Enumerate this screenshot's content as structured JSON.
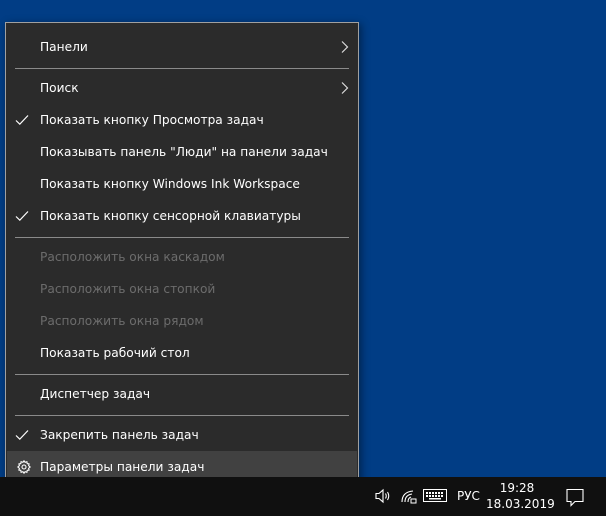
{
  "menu": {
    "items": [
      {
        "label": "Панели",
        "checked": false,
        "disabled": false,
        "submenu": true
      },
      {
        "label": "Поиск",
        "checked": false,
        "disabled": false,
        "submenu": true
      },
      {
        "label": "Показать кнопку Просмотра задач",
        "checked": true,
        "disabled": false
      },
      {
        "label": "Показывать панель \"Люди\" на панели задач",
        "checked": false,
        "disabled": false
      },
      {
        "label": "Показать кнопку Windows Ink Workspace",
        "checked": false,
        "disabled": false
      },
      {
        "label": "Показать кнопку сенсорной клавиатуры",
        "checked": true,
        "disabled": false
      },
      {
        "label": "Расположить окна каскадом",
        "checked": false,
        "disabled": true
      },
      {
        "label": "Расположить окна стопкой",
        "checked": false,
        "disabled": true
      },
      {
        "label": "Расположить окна рядом",
        "checked": false,
        "disabled": true
      },
      {
        "label": "Показать рабочий стол",
        "checked": false,
        "disabled": false
      },
      {
        "label": "Диспетчер задач",
        "checked": false,
        "disabled": false
      },
      {
        "label": "Закрепить панель задач",
        "checked": true,
        "disabled": false
      },
      {
        "label": "Параметры панели задач",
        "checked": false,
        "disabled": false,
        "icon": "gear-icon",
        "highlighted": true
      }
    ]
  },
  "taskbar": {
    "language": "РУС",
    "time": "19:28",
    "date": "18.03.2019",
    "tray_icons": [
      "volume-icon",
      "wifi-icon",
      "keyboard-icon",
      "notification-icon"
    ]
  },
  "colors": {
    "desktop": "#013d85",
    "menu_bg": "#2b2b2b",
    "menu_highlight": "#414141",
    "disabled_text": "#6c6c6c",
    "taskbar": "#101010"
  }
}
